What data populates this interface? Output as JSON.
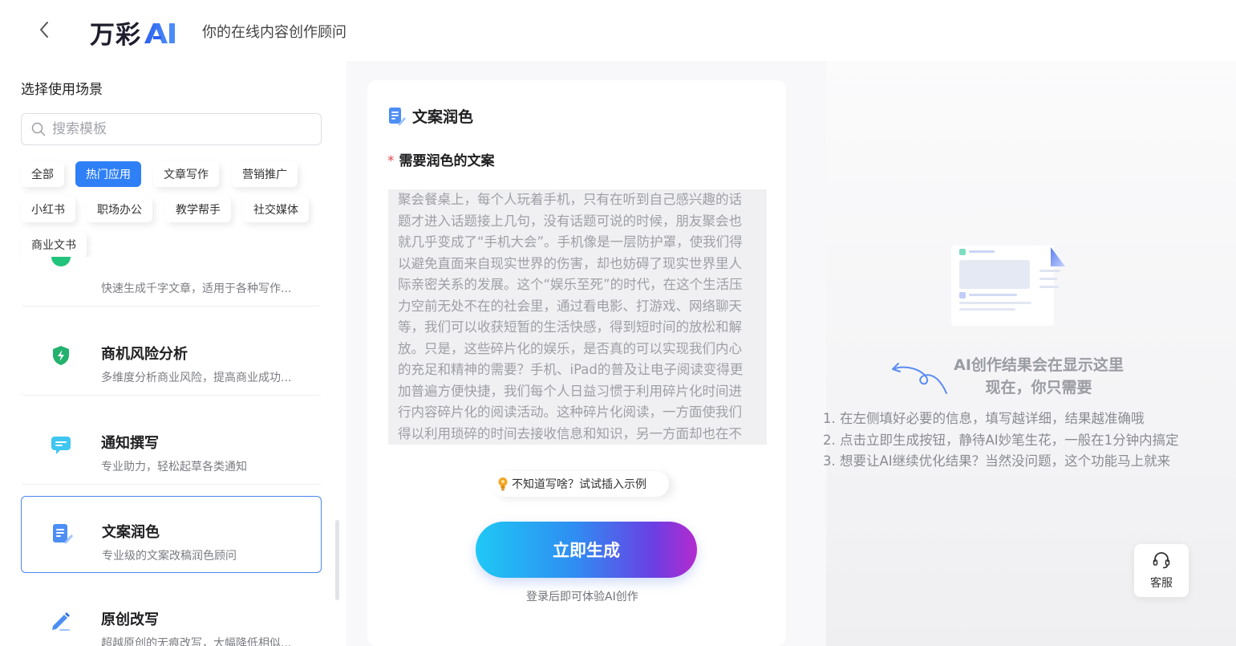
{
  "header": {
    "brand_cn": "万彩",
    "brand_ai": "AI",
    "slogan": "你的在线内容创作顾问"
  },
  "sidebar": {
    "title": "选择使用场景",
    "search_placeholder": "搜索模板",
    "chips": [
      {
        "label": "全部",
        "active": false
      },
      {
        "label": "热门应用",
        "active": true
      },
      {
        "label": "文章写作",
        "active": false
      },
      {
        "label": "营销推广",
        "active": false
      },
      {
        "label": "小红书",
        "active": false
      },
      {
        "label": "职场办公",
        "active": false
      },
      {
        "label": "教学帮手",
        "active": false
      },
      {
        "label": "社交媒体",
        "active": false
      },
      {
        "label": "商业文书",
        "active": false
      }
    ],
    "templates": [
      {
        "title": "",
        "desc": "快速生成千字文章，适用于各种写作...",
        "icon": "article-icon"
      },
      {
        "title": "商机风险分析",
        "desc": "多维度分析商业风险，提高商业成功...",
        "icon": "shield-bolt-icon"
      },
      {
        "title": "通知撰写",
        "desc": "专业助力，轻松起草各类通知",
        "icon": "chat-bubble-icon"
      },
      {
        "title": "文案润色",
        "desc": "专业级的文案改稿润色顾问",
        "icon": "document-pen-icon",
        "active": true
      },
      {
        "title": "原创改写",
        "desc": "超越原创的无痕改写，大幅降低相似...",
        "icon": "pencil-icon"
      }
    ]
  },
  "form": {
    "title": "文案润色",
    "field_required_mark": "*",
    "field_label": "需要润色的文案",
    "text_value": "聚会餐桌上，每个人玩着手机，只有在听到自己感兴趣的话题才进入话题接上几句，没有话题可说的时候，朋友聚会也就几乎变成了“手机大会”。手机像是一层防护罩，使我们得以避免直面来自现实世界的伤害，却也妨碍了现实世界里人际亲密关系的发展。这个“娱乐至死”的时代，在这个生活压力空前无处不在的社会里，通过看电影、打游戏、网络聊天等，我们可以收获短暂的生活快感，得到短时间的放松和解放。只是，这些碎片化的娱乐，是否真的可以实现我们内心的充足和精神的需要？手机、iPad的普及让电子阅读变得更加普遍方便快捷，我们每个人日益习惯于利用碎片化时间进行内容碎片化的阅读活动。这种碎片化阅读，一方面使我们得以利用琐碎的时间去接收信息和知识，另一方面却也在不知不觉中",
    "example_label": "不知道写啥？试试插入示例",
    "generate_label": "立即生成",
    "login_tip": "登录后即可体验AI创作"
  },
  "result": {
    "title_line1": "AI创作结果会在显示这里",
    "title_line2": "现在，你只需要",
    "steps": [
      "1. 在左侧填好必要的信息，填写越详细，结果越准确哦",
      "2. 点击立即生成按钮，静待AI妙笔生花，一般在1分钟内搞定",
      "3. 想要让AI继续优化结果？当然没问题，这个功能马上就来"
    ]
  },
  "service": {
    "label": "客服",
    "icon": "headset-icon"
  },
  "colors": {
    "primary": "#2f80f6",
    "active_border": "#4a86ef",
    "required": "#e5484d"
  }
}
